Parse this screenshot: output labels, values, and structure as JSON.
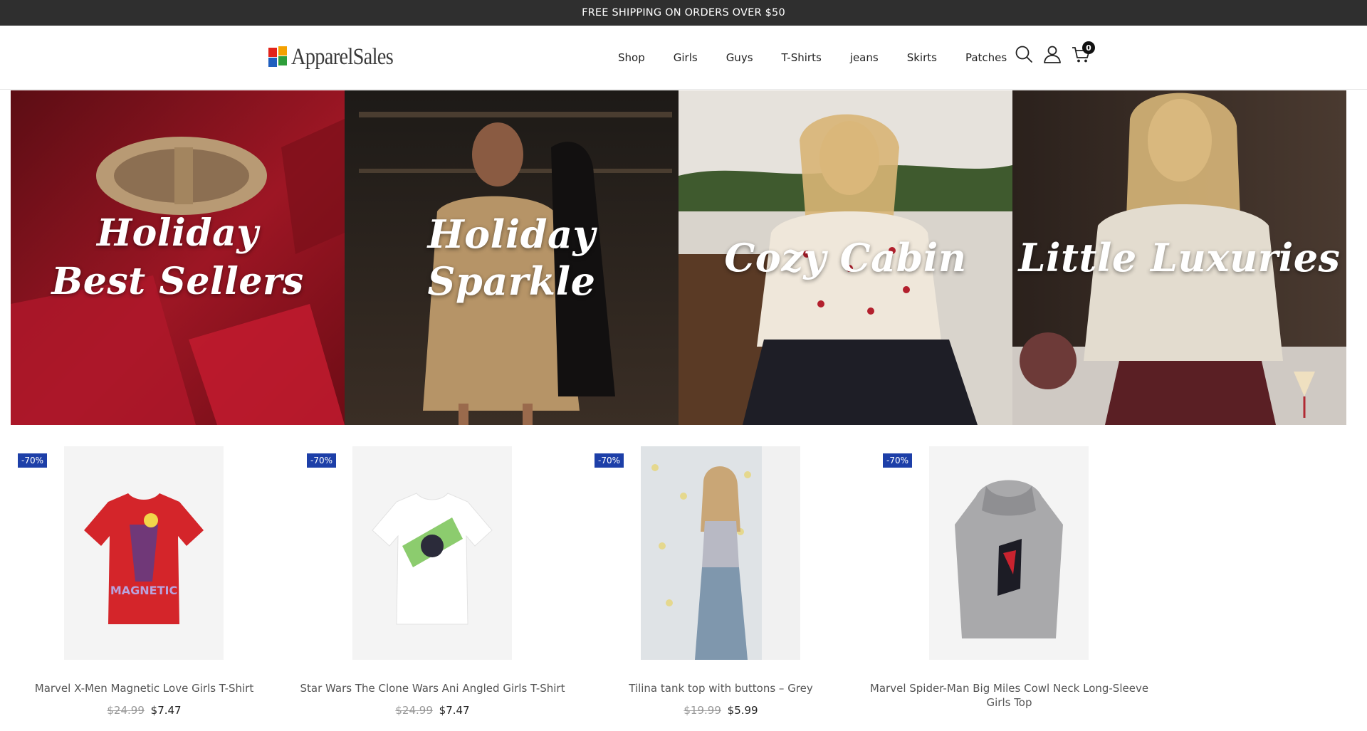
{
  "announcement": "FREE SHIPPING ON ORDERS OVER $50",
  "logo": {
    "text": "ApparelSales",
    "icon": "color-blocks-logo-icon"
  },
  "nav": {
    "items": [
      {
        "label": "Shop"
      },
      {
        "label": "Girls"
      },
      {
        "label": "Guys"
      },
      {
        "label": "T-Shirts"
      },
      {
        "label": "jeans"
      },
      {
        "label": "Skirts"
      },
      {
        "label": "Patches"
      }
    ],
    "icons": [
      "search-icon",
      "account-icon",
      "cart-icon"
    ],
    "cart_count": "0"
  },
  "banners": [
    {
      "title_line1": "Holiday",
      "title_line2": "Best Sellers"
    },
    {
      "title": "Holiday Sparkle"
    },
    {
      "title": "Cozy Cabin"
    },
    {
      "title": "Little Luxuries"
    }
  ],
  "products": [
    {
      "badge": "-70%",
      "name": "Marvel X-Men Magnetic Love Girls T-Shirt",
      "old_price": "$24.99",
      "new_price": "$7.47"
    },
    {
      "badge": "-70%",
      "name": "Star Wars The Clone Wars Ani Angled Girls T-Shirt",
      "old_price": "$24.99",
      "new_price": "$7.47"
    },
    {
      "badge": "-70%",
      "name": "Tilina tank top with buttons – Grey",
      "old_price": "$19.99",
      "new_price": "$5.99"
    },
    {
      "badge": "-70%",
      "name": "Marvel Spider-Man Big Miles Cowl Neck Long-Sleeve Girls Top",
      "old_price": "",
      "new_price": ""
    }
  ],
  "colors": {
    "topbar": "#2f2f2f",
    "sale_badge": "#1d3fa8",
    "cart_badge": "#111111"
  }
}
